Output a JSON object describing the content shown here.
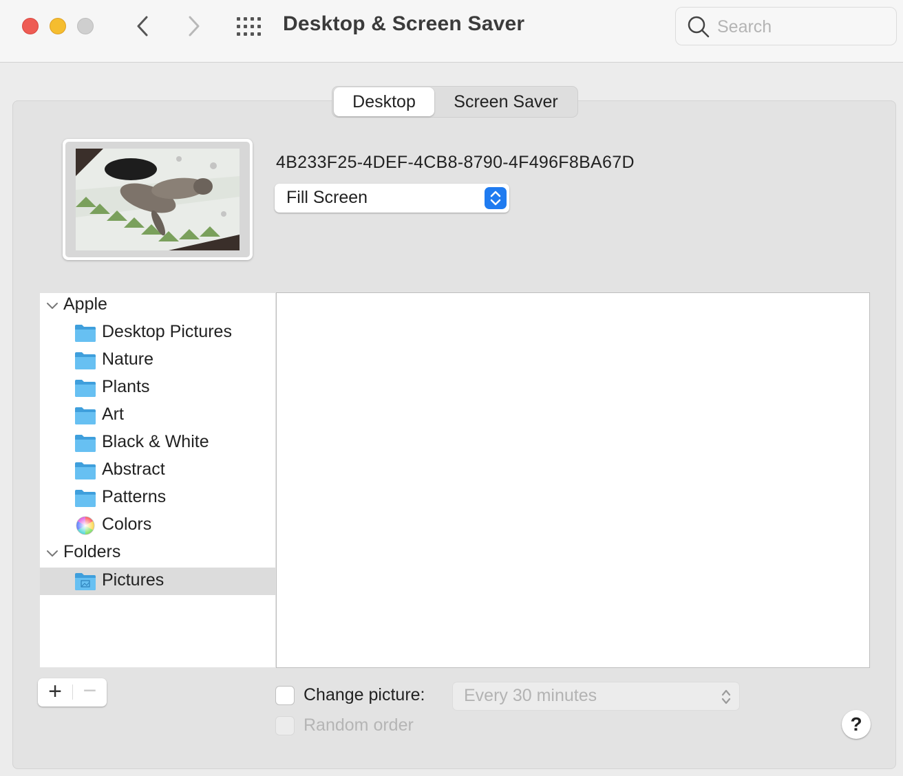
{
  "window": {
    "title": "Desktop & Screen Saver"
  },
  "search": {
    "placeholder": "Search"
  },
  "tabs": [
    {
      "label": "Desktop",
      "selected": true
    },
    {
      "label": "Screen Saver",
      "selected": false
    }
  ],
  "current_picture": {
    "name": "4B233F25-4DEF-4CB8-8790-4F496F8BA67D",
    "fit_option": "Fill Screen"
  },
  "sources": {
    "apple": {
      "label": "Apple",
      "expanded": true,
      "items": [
        {
          "label": "Desktop Pictures",
          "icon": "folder-icon"
        },
        {
          "label": "Nature",
          "icon": "folder-icon"
        },
        {
          "label": "Plants",
          "icon": "folder-icon"
        },
        {
          "label": "Art",
          "icon": "folder-icon"
        },
        {
          "label": "Black & White",
          "icon": "folder-icon"
        },
        {
          "label": "Abstract",
          "icon": "folder-icon"
        },
        {
          "label": "Patterns",
          "icon": "folder-icon"
        },
        {
          "label": "Colors",
          "icon": "color-wheel-icon"
        }
      ]
    },
    "folders": {
      "label": "Folders",
      "expanded": true,
      "items": [
        {
          "label": "Pictures",
          "icon": "pictures-folder-icon",
          "selected": true
        }
      ]
    }
  },
  "controls": {
    "add_label": "+",
    "remove_label": "−",
    "change_picture_label": "Change picture:",
    "change_picture_checked": false,
    "interval": "Every 30 minutes",
    "random_order_label": "Random order",
    "random_order_enabled": false,
    "help_label": "?"
  },
  "colors": {
    "accent": "#1f7bf0",
    "close": "#ee5c54",
    "minimize": "#f5bd2f",
    "zoom_disabled": "#cfcfcf",
    "folder": "#4fb3ec",
    "selection": "#dcdcdc"
  }
}
